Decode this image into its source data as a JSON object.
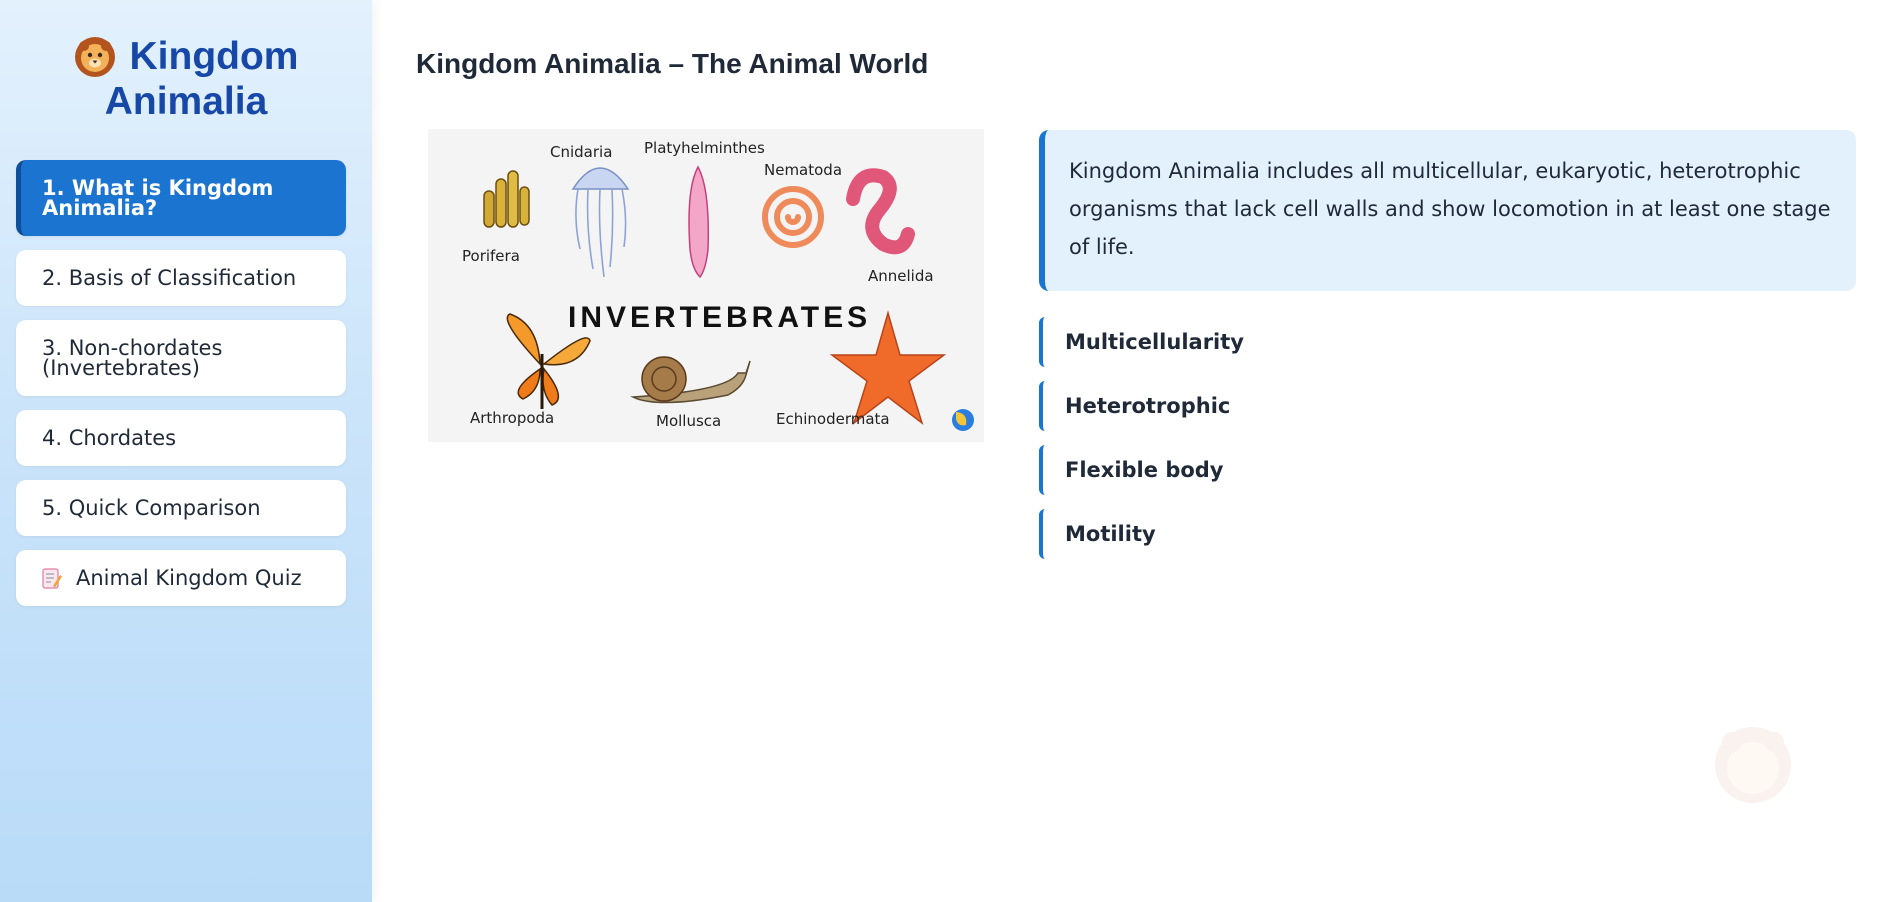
{
  "sidebar": {
    "brand_line1": "Kingdom",
    "brand_line2": "Animalia",
    "brand_icon": "lion-icon",
    "nav": [
      {
        "label": "1. What is Kingdom Animalia?",
        "active": true
      },
      {
        "label": "2. Basis of Classification"
      },
      {
        "label": "3. Non-chordates (Invertebrates)"
      },
      {
        "label": "4. Chordates"
      },
      {
        "label": "5. Quick Comparison"
      },
      {
        "label": "Animal Kingdom Quiz",
        "icon": "memo-icon"
      }
    ]
  },
  "main": {
    "title": "Kingdom Animalia – The Animal World",
    "figure": {
      "title": "INVERTEBRATES",
      "labels": {
        "cnidaria": "Cnidaria",
        "platyhelminthes": "Platyhelminthes",
        "nematoda": "Nematoda",
        "porifera": "Porifera",
        "annelida": "Annelida",
        "arthropoda": "Arthropoda",
        "mollusca": "Mollusca",
        "echinodermata": "Echinodermata"
      }
    },
    "intro": "Kingdom Animalia includes all multicellular, eukaryotic, heterotrophic organisms that lack cell walls and show locomotion in at least one stage of life.",
    "features": [
      "Multicellularity",
      "Heterotrophic",
      "Flexible body",
      "Motility"
    ]
  },
  "colors": {
    "accent": "#1b75d0",
    "brand": "#1748a8",
    "card_bg": "#e3f1fd"
  }
}
